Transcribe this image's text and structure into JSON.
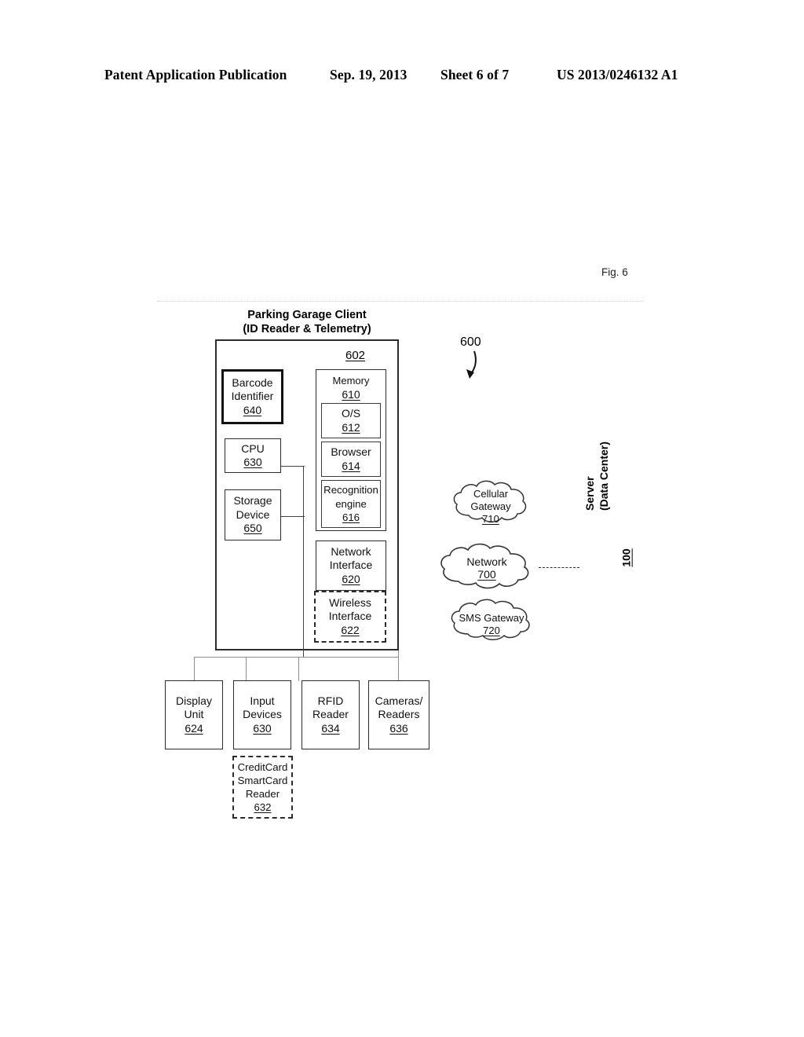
{
  "header": {
    "publication": "Patent Application Publication",
    "date": "Sep. 19, 2013",
    "sheet": "Sheet 6 of 7",
    "number": "US 2013/0246132 A1"
  },
  "figure": {
    "label": "Fig. 6",
    "system_ref": "600"
  },
  "client": {
    "title_line1": "Parking Garage Client",
    "title_line2": "(ID Reader & Telemetry)",
    "container_ref": "602"
  },
  "blocks": {
    "barcode": {
      "line1": "Barcode",
      "line2": "Identifier",
      "ref": "640"
    },
    "cpu": {
      "line1": "CPU",
      "ref": "630"
    },
    "storage": {
      "line1": "Storage",
      "line2": "Device",
      "ref": "650"
    },
    "memory": {
      "line1": "Memory",
      "ref": "610"
    },
    "os": {
      "line1": "O/S",
      "ref": "612"
    },
    "browser": {
      "line1": "Browser",
      "ref": "614"
    },
    "recognition": {
      "line1": "Recognition",
      "line2": "engine",
      "ref": "616"
    },
    "network_interface": {
      "line1": "Network",
      "line2": "Interface",
      "ref": "620"
    },
    "wireless_interface": {
      "line1": "Wireless",
      "line2": "Interface",
      "ref": "622"
    },
    "display_unit": {
      "line1": "Display",
      "line2": "Unit",
      "ref": "624"
    },
    "input_devices": {
      "line1": "Input",
      "line2": "Devices",
      "ref": "630"
    },
    "rfid_reader": {
      "line1": "RFID",
      "line2": "Reader",
      "ref": "634"
    },
    "cameras_readers": {
      "line1": "Cameras/",
      "line2": "Readers",
      "ref": "636"
    },
    "card_reader": {
      "line1": "CreditCard",
      "line2": "SmartCard",
      "line3": "Reader",
      "ref": "632"
    }
  },
  "clouds": {
    "cellular_gateway": {
      "line1": "Cellular",
      "line2": "Gateway",
      "ref": "710"
    },
    "network": {
      "line1": "Network",
      "ref": "700"
    },
    "sms_gateway": {
      "line1": "SMS Gateway",
      "ref": "720"
    }
  },
  "server": {
    "line1": "Server",
    "line2": "(Data Center)",
    "ref": "100"
  }
}
